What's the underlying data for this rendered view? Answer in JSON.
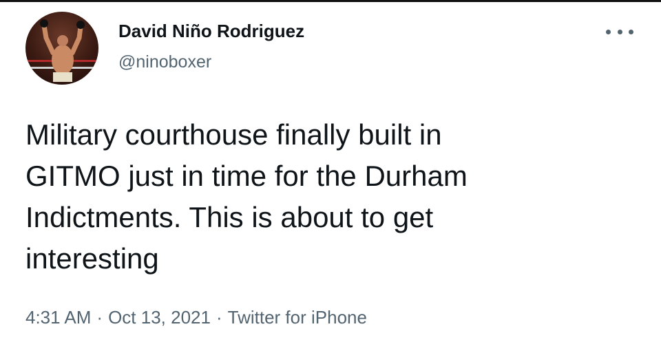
{
  "tweet": {
    "author": {
      "display_name": "David Niño Rodriguez",
      "handle": "@ninoboxer",
      "avatar": "boxer-photo"
    },
    "more_icon": "more-horizontal-icon",
    "text": "Military courthouse finally built in\nGITMO just in time for the Durham\nIndictments. This is about to get\ninteresting",
    "time": "4:31 AM",
    "date": "Oct 13, 2021",
    "source": "Twitter for iPhone",
    "separator": "·"
  },
  "colors": {
    "text": "#0f1419",
    "secondary": "#536471",
    "background": "#ffffff"
  }
}
